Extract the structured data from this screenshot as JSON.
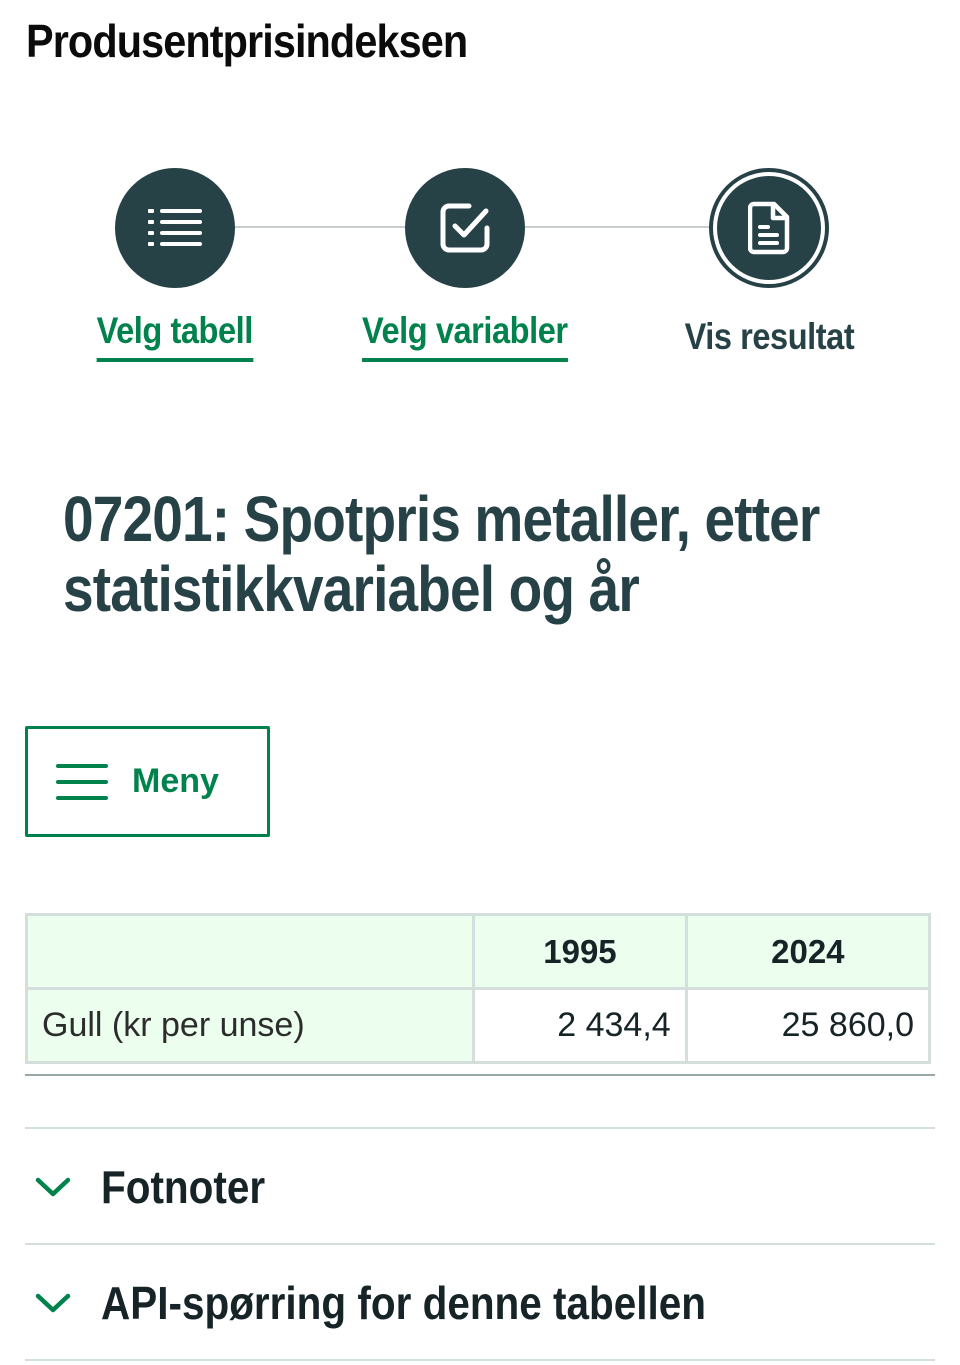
{
  "page_title": "Produsentprisindeksen",
  "stepper": {
    "steps": [
      {
        "label": "Velg tabell",
        "icon": "list-icon"
      },
      {
        "label": "Velg variabler",
        "icon": "checkbox-icon"
      },
      {
        "label": "Vis resultat",
        "icon": "document-icon"
      }
    ],
    "accent_color": "#00824d",
    "circle_color": "#274247"
  },
  "table_heading": "07201: Spotpris metaller, etter statistikkvariabel og år",
  "menu": {
    "label": "Meny",
    "icon": "hamburger-icon"
  },
  "data_table": {
    "columns": [
      "",
      "1995",
      "2024"
    ],
    "rows": [
      {
        "label": "Gull (kr per unse)",
        "values": [
          "2 434,4",
          "25 860,0"
        ]
      }
    ],
    "header_bg": "#ecfeed"
  },
  "accordions": [
    {
      "label": "Fotnoter",
      "icon": "chevron-down-icon"
    },
    {
      "label": "API-spørring for denne tabellen",
      "icon": "chevron-down-icon"
    }
  ]
}
